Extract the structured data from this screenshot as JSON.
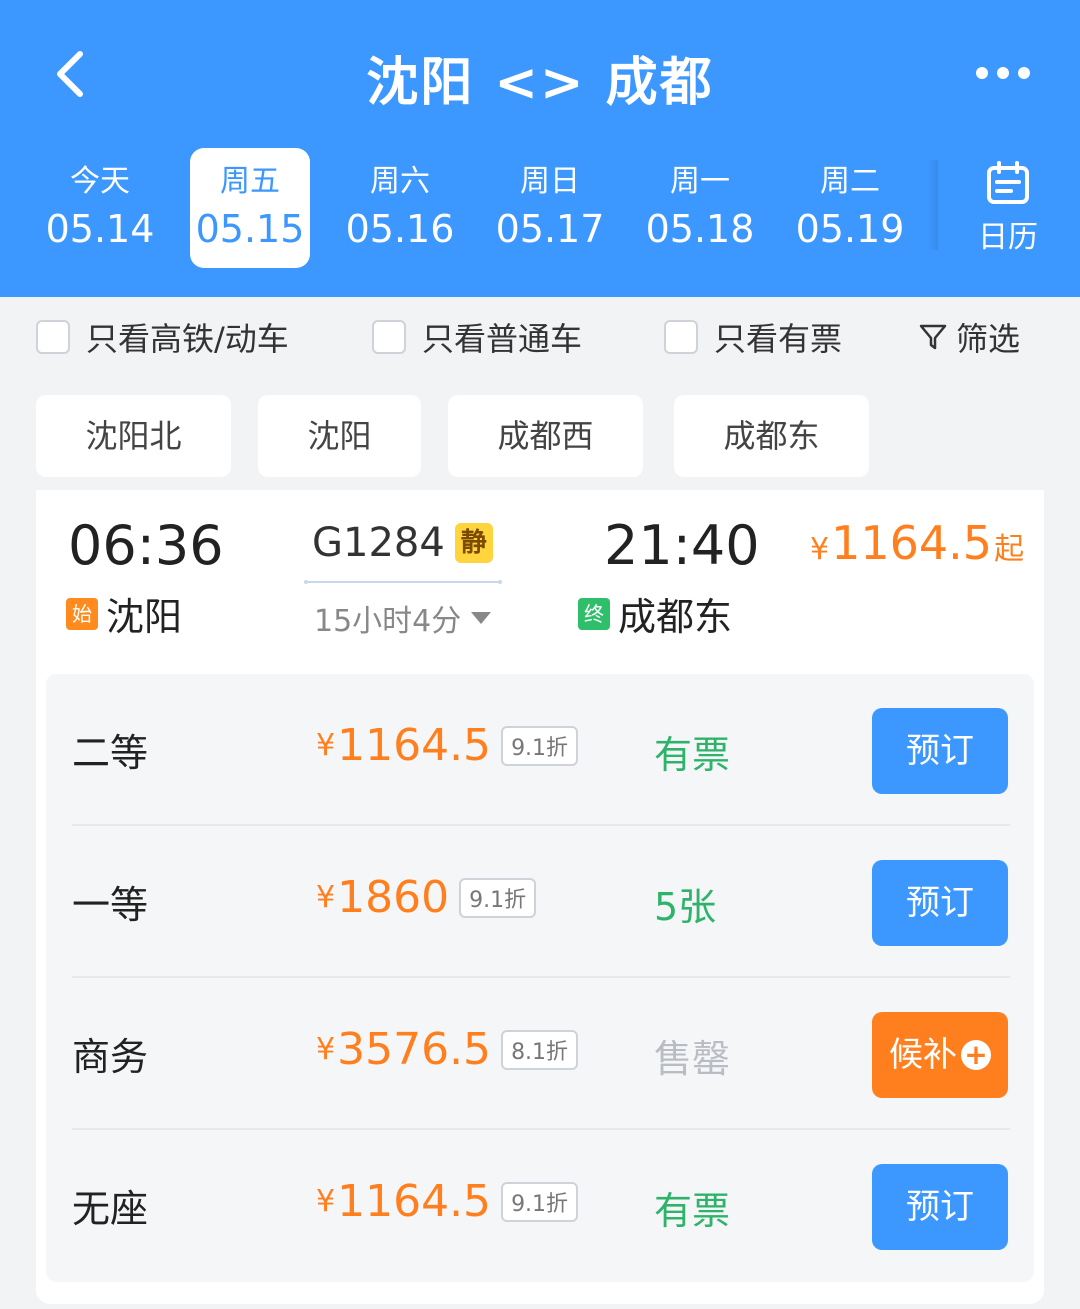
{
  "header": {
    "title": "沈阳 <> 成都",
    "back_icon": "chevron-left-icon",
    "more_icon": "more-dots-icon",
    "bg_color": "#3c97ff"
  },
  "dates": [
    {
      "weekday": "今天",
      "date": "05.14",
      "selected": false
    },
    {
      "weekday": "周五",
      "date": "05.15",
      "selected": true
    },
    {
      "weekday": "周六",
      "date": "05.16",
      "selected": false
    },
    {
      "weekday": "周日",
      "date": "05.17",
      "selected": false
    },
    {
      "weekday": "周一",
      "date": "05.18",
      "selected": false
    },
    {
      "weekday": "周二",
      "date": "05.19",
      "selected": false
    }
  ],
  "calendar": {
    "label": "日历",
    "icon": "calendar-icon"
  },
  "filters": {
    "only_highspeed": "只看高铁/动车",
    "only_normal": "只看普通车",
    "only_available": "只看有票",
    "filter_label": "筛选"
  },
  "stations": [
    "沈阳北",
    "沈阳",
    "成都西",
    "成都东"
  ],
  "train": {
    "depart_time": "06:36",
    "depart_tag": "始",
    "depart_station": "沈阳",
    "number": "G1284",
    "quiet_tag": "静",
    "duration": "15小时4分",
    "arrive_time": "21:40",
    "arrive_tag": "终",
    "arrive_station": "成都东",
    "min_price_currency": "¥",
    "min_price": "1164.5",
    "min_price_suffix": "起"
  },
  "seats": [
    {
      "name": "二等",
      "currency": "¥",
      "price": "1164.5",
      "discount": "9.1折",
      "status": "有票",
      "status_type": "available",
      "action": "预订"
    },
    {
      "name": "一等",
      "currency": "¥",
      "price": "1860",
      "discount": "9.1折",
      "status": "5张",
      "status_type": "available",
      "action": "预订"
    },
    {
      "name": "商务",
      "currency": "¥",
      "price": "3576.5",
      "discount": "8.1折",
      "status": "售罄",
      "status_type": "sold_out",
      "action": "候补"
    },
    {
      "name": "无座",
      "currency": "¥",
      "price": "1164.5",
      "discount": "9.1折",
      "status": "有票",
      "status_type": "available",
      "action": "预订"
    }
  ]
}
